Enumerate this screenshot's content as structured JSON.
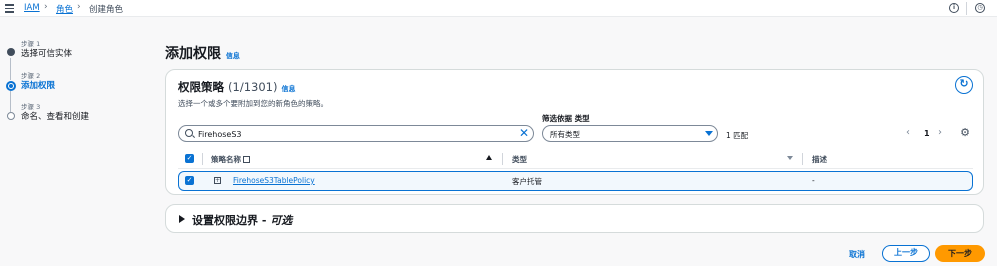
{
  "breadcrumb": {
    "root": "IAM",
    "roles": "角色",
    "current": "创建角色"
  },
  "steps": [
    {
      "label": "步骤 1",
      "title": "选择可信实体",
      "state": "completed"
    },
    {
      "label": "步骤 2",
      "title": "添加权限",
      "state": "current"
    },
    {
      "label": "步骤 3",
      "title": "命名、查看和创建",
      "state": "pending"
    }
  ],
  "page": {
    "title": "添加权限",
    "info": "信息"
  },
  "policies": {
    "title": "权限策略",
    "count": "(1/1301)",
    "info": "信息",
    "description": "选择一个或多个要附加到您的新角色的策略。",
    "search_value": "FirehoseS3",
    "filter_label": "筛选依据 类型",
    "filter_value": "所有类型",
    "match_count": "1 匹配",
    "page_number": "1",
    "columns": {
      "name": "策略名称",
      "type": "类型",
      "description": "描述"
    },
    "rows": [
      {
        "name": "FirehoseS3TablePolicy",
        "type": "客户托管",
        "description": "-",
        "selected": true
      }
    ]
  },
  "boundary": {
    "title_main": "设置权限边界 - ",
    "title_optional": "可选"
  },
  "footer": {
    "cancel": "取消",
    "previous": "上一步",
    "next": "下一步"
  },
  "colors": {
    "accent": "#0972d3",
    "primary_button": "#ff9900",
    "text": "#16191f"
  },
  "icons": [
    "menu-icon",
    "info-icon",
    "notifications-icon",
    "refresh-icon",
    "search-icon",
    "clear-icon",
    "settings-icon",
    "external-link-icon",
    "expand-icon"
  ]
}
